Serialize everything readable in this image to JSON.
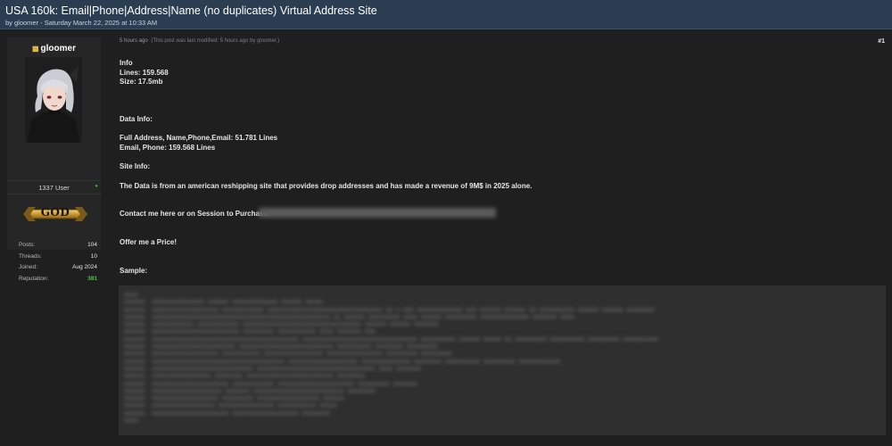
{
  "thread": {
    "title": "USA 160k: Email|Phone|Address|Name (no duplicates) Virtual Address Site",
    "subtitle": "by gloomer - Saturday March 22, 2025 at 10:33 AM"
  },
  "user": {
    "username": "gloomer",
    "usertitle": "1337 User",
    "rank_badge": "GOD",
    "stats": [
      {
        "label": "Posts:",
        "value": "104"
      },
      {
        "label": "Threads:",
        "value": "10"
      },
      {
        "label": "Joined:",
        "value": "Aug 2024"
      },
      {
        "label": "Reputation:",
        "value": "381"
      }
    ],
    "colors": {
      "reputation": "#4ec24e",
      "online": "#3cb043"
    }
  },
  "post": {
    "time": "5 hours ago",
    "modified_note": "(This post was last modified: 5 hours ago by gloomer.)",
    "number": "#1",
    "lines": {
      "info": "Info",
      "lines_count": "Lines: 159.568",
      "size": "Size:  17.5mb",
      "data_info": "Data Info:",
      "full_address": "Full Address, Name,Phone,Email: 51.781 Lines",
      "email_phone": "Email, Phone: 159.568 Lines",
      "site_info": "Site Info:",
      "description": "The Data is from an american reshipping site that provides drop addresses and has made a revenue of 9M$ in 2025 alone.",
      "contact": "Contact me here or on Session to Purchase:",
      "offer": "Offer me a Price!",
      "sample": "Sample:"
    },
    "sample_text": "xxxx\nxxxxxx  xxxxxxxxxxxxxxx xxxxxx xxxxxxxxxxxxx xxxxxx xxxxx\nxxxxxx  xxxxxxxxxxxxxxxxxxx xxxxxxxxxxxx xxxxxxxxxxxxxxxxxxxxxxxxxxxxxxxxx xx x xxx xxxxxxxxxxxxx xxx xxxxxx xxxxxx xx xxxxxxxxxx xxxxxx xxxxxx xxxxxxxx\nxxxxxx  xxxxxxxxxxxxxxxxxxxxxxxxxxxxxxxxxxxxxxxxxxxxxxxxxxx xx xxxxxx xxxxxxxxx xxxx xxxxxx xxxxxxxxx xxxxxxxxxxxxxx xxxxxxx xxxx\nxxxxxx  xxxxxxxxxxxx xxxxxxxxxxxx xxxxxxxxxxxxxxxxxxxxxxxxxxxxxxxxxx xxxxxx xxxxxx xxxxxxx\nxxxxxx  xxxxxxxxxxxxxxxxxxxxxxxxx xxxxxxxxx xxxxxxxxxxx xxxx xxxxxxx xxx\nxxxxxx  xxxxxxxxxxxxxxxxxxxxxxxxxxxxxxxxxxxxxxxxxx xxxxxxxxxxxxxxxxxxxxxxxxxxxxxxxxx xxxxxxxxxx xxxxxx xxxxx xx xxxxxxxxx xxxxxxxxxx xxxxxxxxx xxxxxxxxxx\nxxxxxx  xxxxxxxxxxxxxxxxxxxxxxxx xxxxxxxxxxxxxxxxxxxxxxxxxxx xxxxxxxxxx xxxxxxxx xxxxxxxxx\nxxxxxx  xxxxxxxxxxxxxxxxxxx xxxxxxxxxxx xxxxxxxxxxxxxxxxx xxxxxxxxxxxxxxxx xxxxxxxxx xxxxxxxxx\nxxxxxx  xxxxxxxxxxxxxxxxxxxxxxxxxxxxxxxxxxxxxx xxxxxxxxxxxxxxxxxxxx xxxxxxxxxxxxxx xxxxxxxx xxxxxxxxxx xxxxxxxxx xxxxxxxxxxxx\nxxxxxx  xxxxxxxxxxxxxxxxxxxxxxxxxxxxx xxxxxxxxxxxxxxxxxxxxxxxxxxxxxxxxxx xxxx xxxxxxx\nxxxxxx  xxxxxxxxxxxxxxxxx xxxxxxxx xxxxxxxxxxxxxxxxxxxxxxxxx xxxxxxxx\nxxxxxx  xxxxxxxxxxxxxxxxxxxxxx xxxxxxxxxxxx xxxxxxxxxxxxxxxxxxxxxx xxxxxxxxx xxxxxxx\nxxxxxx  xxxxxxxxxxxxxxxxxxxx xxxxxxx xxxxxxxxxxxxxxxxxxxxxxxxxx xxxxxxxx\nxxxxxx  xxxxxxxxxxxxxxxxxxx xxxxxxxxx xxxxxxxxxxxxxxxxxx xxxxxx\nxxxxxx  xxxxxxxxxxxxxxxxxx xxxxxxxxxxxxxxxx xxxxxxxxxxx xxxxx\nxxxxxx  xxxxxxxxxxxxxxxxxxxxxx xxxxxxxxxxxxxxxxxxx xxxxxxxx\nxxxx"
  }
}
